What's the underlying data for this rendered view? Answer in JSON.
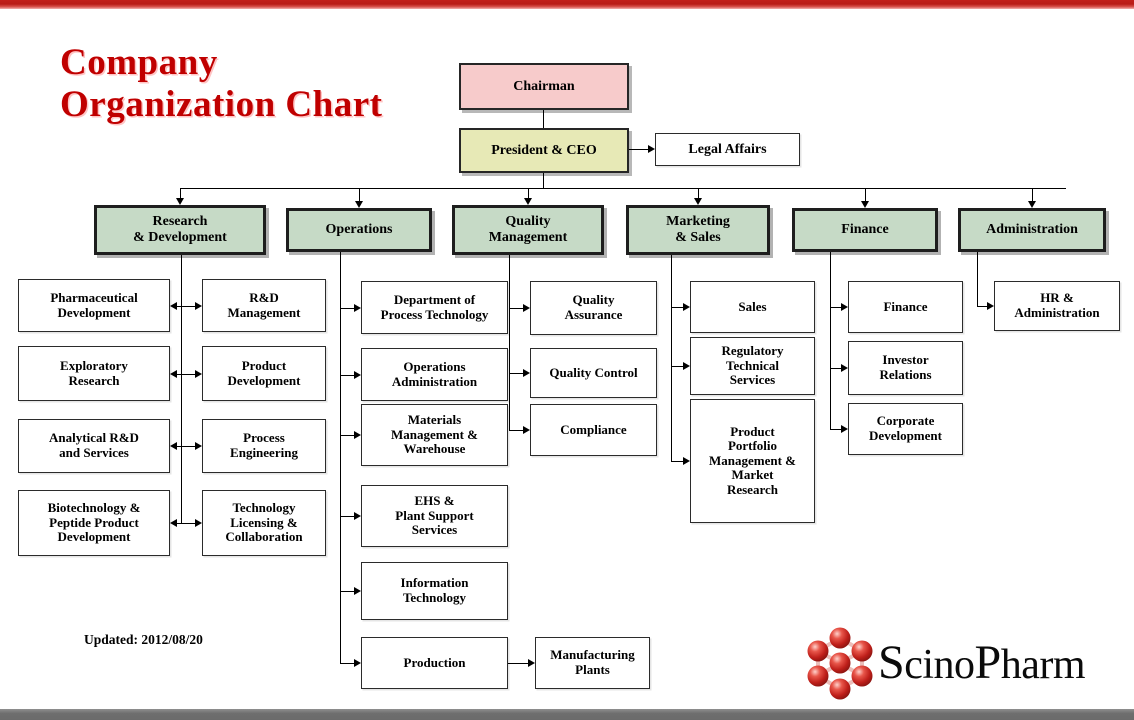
{
  "page": {
    "title_line1": "Company",
    "title_line2": "Organization Chart",
    "updated": "Updated: 2012/08/20",
    "accent_red": "#C00000",
    "topbar_color": "#B81C17",
    "bottombar_color": "#6E6E6E"
  },
  "logo": {
    "name": "ScinoPharm",
    "text_part1": "S",
    "text_part2": "cino",
    "text_part3": "P",
    "text_part4": "harm",
    "sphere_color": "#C0201C"
  },
  "executive": {
    "chairman": {
      "label": "Chairman",
      "fill": "#F7CBCB"
    },
    "ceo": {
      "label": "President & CEO",
      "fill": "#E7E9B6"
    },
    "legal": {
      "label": "Legal Affairs",
      "fill": "#FFFFFF"
    }
  },
  "divisions": [
    {
      "id": "rnd",
      "label": "Research\n& Development",
      "lines": [
        "Research",
        "& Development"
      ],
      "fill": "#C6DAC6"
    },
    {
      "id": "operations",
      "label": "Operations",
      "lines": [
        "Operations"
      ],
      "fill": "#C6DAC6"
    },
    {
      "id": "quality",
      "label": "Quality Management",
      "lines": [
        "Quality",
        "Management"
      ],
      "fill": "#C6DAC6"
    },
    {
      "id": "marketing",
      "label": "Marketing & Sales",
      "lines": [
        "Marketing",
        "& Sales"
      ],
      "fill": "#C6DAC6"
    },
    {
      "id": "finance",
      "label": "Finance",
      "lines": [
        "Finance"
      ],
      "fill": "#C6DAC6"
    },
    {
      "id": "admin",
      "label": "Administration",
      "lines": [
        "Administration"
      ],
      "fill": "#C6DAC6"
    }
  ],
  "departments": {
    "rnd_left": [
      {
        "lines": [
          "Pharmaceutical",
          "Development"
        ]
      },
      {
        "lines": [
          "Exploratory",
          "Research"
        ]
      },
      {
        "lines": [
          "Analytical R&D",
          "and Services"
        ]
      },
      {
        "lines": [
          "Biotechnology &",
          "Peptide Product",
          "Development"
        ]
      }
    ],
    "rnd_right": [
      {
        "lines": [
          "R&D",
          "Management"
        ]
      },
      {
        "lines": [
          "Product",
          "Development"
        ]
      },
      {
        "lines": [
          "Process",
          "Engineering"
        ]
      },
      {
        "lines": [
          "Technology",
          "Licensing &",
          "Collaboration"
        ]
      }
    ],
    "operations": [
      {
        "lines": [
          "Department of",
          "Process Technology"
        ]
      },
      {
        "lines": [
          "Operations",
          "Administration"
        ]
      },
      {
        "lines": [
          "Materials",
          "Management &",
          "Warehouse"
        ]
      },
      {
        "lines": [
          "EHS &",
          "Plant Support",
          "Services"
        ]
      },
      {
        "lines": [
          "Information",
          "Technology"
        ]
      },
      {
        "lines": [
          "Production"
        ]
      }
    ],
    "operations_sub": [
      {
        "lines": [
          "Manufacturing",
          "Plants"
        ]
      }
    ],
    "quality": [
      {
        "lines": [
          "Quality",
          "Assurance"
        ]
      },
      {
        "lines": [
          "Quality  Control"
        ]
      },
      {
        "lines": [
          "Compliance"
        ]
      }
    ],
    "marketing": [
      {
        "lines": [
          "Sales"
        ]
      },
      {
        "lines": [
          "Regulatory",
          "Technical",
          "Services"
        ]
      },
      {
        "lines": [
          "Product",
          "Portfolio",
          "Management &",
          "Market",
          "Research"
        ]
      }
    ],
    "finance": [
      {
        "lines": [
          "Finance"
        ]
      },
      {
        "lines": [
          "Investor",
          "Relations"
        ]
      },
      {
        "lines": [
          "Corporate",
          "Development"
        ]
      }
    ],
    "admin": [
      {
        "lines": [
          "HR &",
          "Administration"
        ]
      }
    ]
  }
}
